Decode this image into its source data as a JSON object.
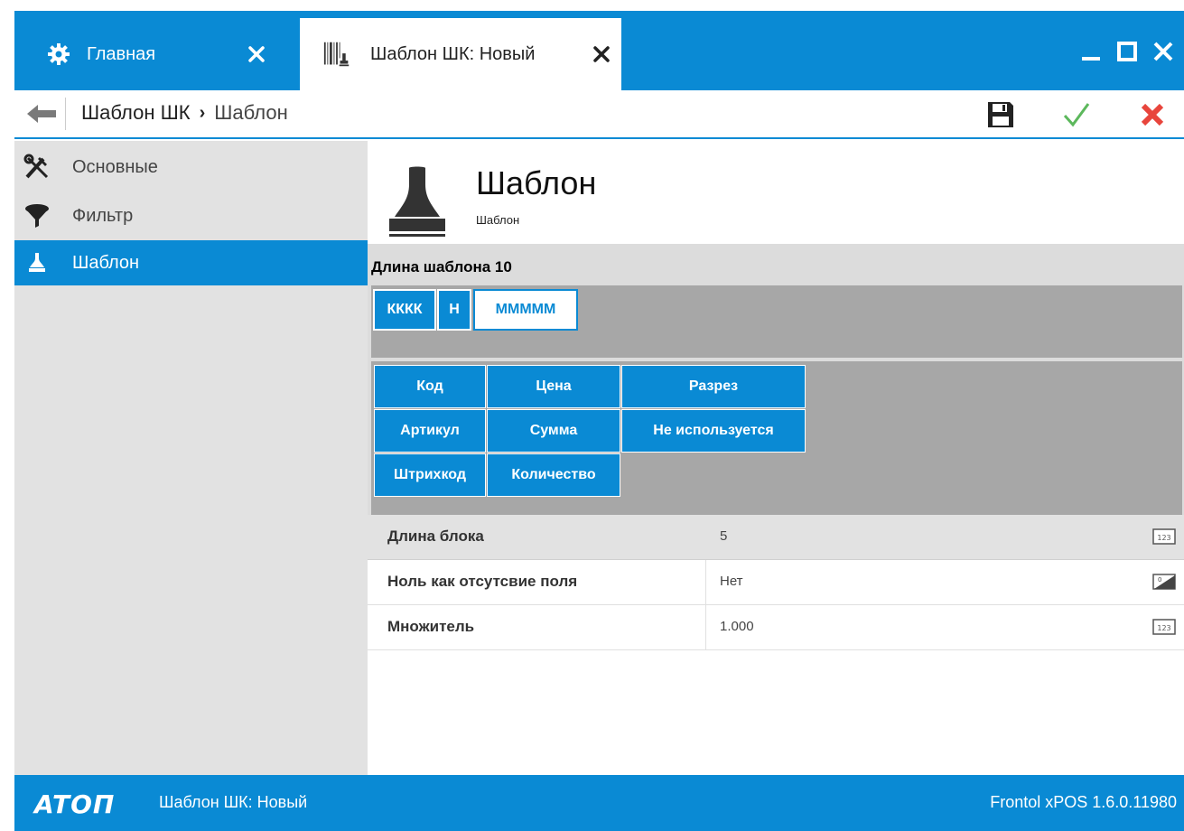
{
  "tabs": [
    {
      "label": "Главная",
      "icon": "gear-icon"
    },
    {
      "label": "Шаблон ШК: Новый",
      "icon": "barcode-stamp-icon"
    }
  ],
  "breadcrumb": {
    "parent": "Шаблон ШК",
    "separator": "›",
    "current": "Шаблон"
  },
  "sidebar": {
    "items": [
      {
        "label": "Основные",
        "icon": "tools-icon"
      },
      {
        "label": "Фильтр",
        "icon": "filter-icon"
      },
      {
        "label": "Шаблон",
        "icon": "stamp-icon"
      }
    ]
  },
  "header": {
    "title": "Шаблон",
    "subtitle": "Шаблон"
  },
  "template": {
    "length_label": "Длина шаблона 10",
    "segments": [
      "КККК",
      "Н",
      "МММММ"
    ],
    "selected_segment": "МММММ"
  },
  "field_buttons": [
    "Код",
    "Цена",
    "Разрез",
    "Артикул",
    "Сумма",
    "Не используется",
    "Штрихкод",
    "Количество"
  ],
  "properties": [
    {
      "name": "Длина блока",
      "value": "5",
      "icon": "numeric-123-icon"
    },
    {
      "name": "Ноль как отсутсвие поля",
      "value": "Нет",
      "icon": "toggle-0-1-icon"
    },
    {
      "name": "Множитель",
      "value": "1.000",
      "icon": "numeric-123-icon"
    }
  ],
  "status": {
    "logo": "ATOΠ",
    "document": "Шаблон ШК: Новый",
    "version": "Frontol xPOS 1.6.0.11980"
  },
  "colors": {
    "accent": "#0a8ad4",
    "panel_gray": "#a7a7a7",
    "sidebar_bg": "#e2e2e2",
    "confirm": "#5cb85c",
    "cancel": "#e8453c"
  }
}
